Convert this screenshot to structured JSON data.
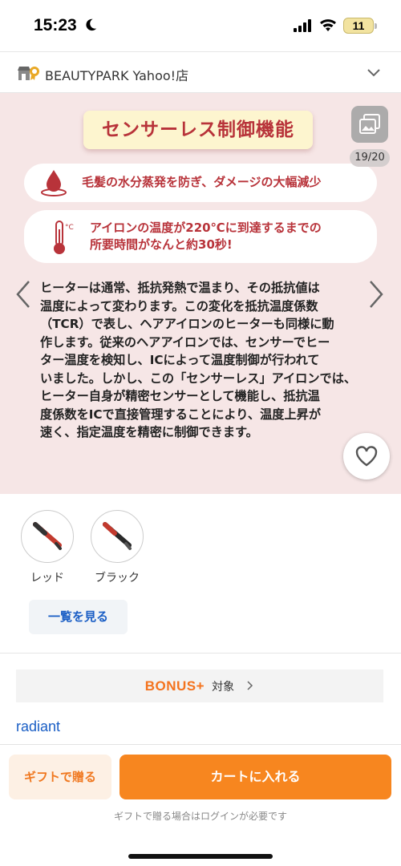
{
  "status_bar": {
    "time": "15:23",
    "battery": "11"
  },
  "store": {
    "name": "BEAUTYPARK Yahoo!店"
  },
  "image": {
    "feature_title": "センサーレス制御機能",
    "highlight1": "毛髪の水分蒸発を防ぎ、ダメージの大幅減少",
    "highlight2_line1": "アイロンの温度が220℃に到達するまでの",
    "highlight2_line2": "所要時間がなんと約30秒!",
    "body_lines": [
      "ヒーターは通常、抵抗発熱で温まり、その抵抗値は",
      "温度によって変わります。この変化を抵抗温度係数",
      "（TCR）で表し、ヘアアイロンのヒーターも同様に動",
      "作します。従来のヘアアイロンでは、センサーでヒー",
      "ター温度を検知し、ICによって温度制御が行われて",
      "いました。しかし、この「センサーレス」アイロンでは、",
      "ヒーター自身が精密センサーとして機能し、抵抗温",
      "度係数をICで直接管理することにより、温度上昇が",
      "速く、指定温度を精密に制御できます。"
    ],
    "counter": "19/20",
    "thermo_unit": "°C"
  },
  "variants": [
    {
      "label": "レッド",
      "color": "#c23a2e"
    },
    {
      "label": "ブラック",
      "color": "#2a2a2a"
    }
  ],
  "view_all_label": "一覧を見る",
  "bonus": {
    "logo": "BONUS+",
    "label": "対象"
  },
  "brand_link": "radiant",
  "bottom": {
    "gift_label": "ギフトで贈る",
    "cart_label": "カートに入れる",
    "login_note": "ギフトで贈る場合はログインが必要です"
  },
  "colors": {
    "accent_orange": "#f7861f",
    "link_blue": "#1a5ec5",
    "feature_red": "#b8333a"
  }
}
